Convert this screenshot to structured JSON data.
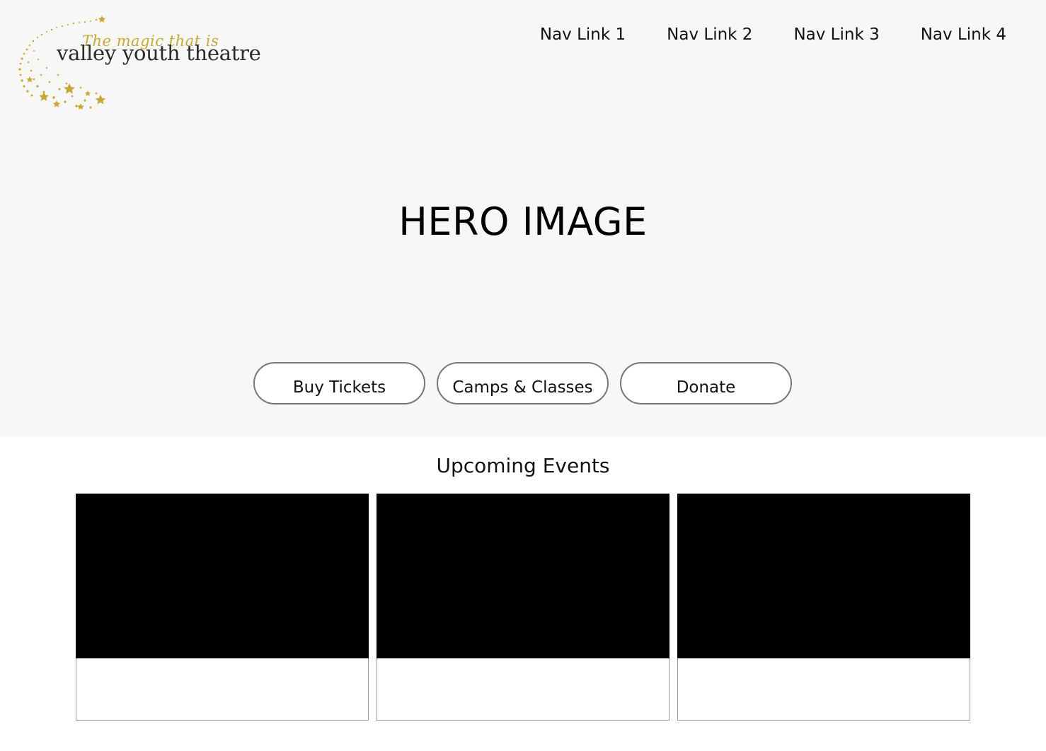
{
  "brand": {
    "tagline": "The magic that is",
    "name": "valley youth theatre",
    "accent_color": "#c6a832",
    "logo_icon": "shooting-stars-icon"
  },
  "nav": {
    "links": [
      "Nav Link 1",
      "Nav Link 2",
      "Nav Link 3",
      "Nav Link 4"
    ]
  },
  "hero": {
    "title": "HERO IMAGE",
    "buttons": [
      "Buy Tickets",
      "Camps & Classes",
      "Donate"
    ]
  },
  "events": {
    "title": "Upcoming Events",
    "cards": [
      {
        "image_color": "#000000"
      },
      {
        "image_color": "#000000"
      },
      {
        "image_color": "#000000"
      }
    ]
  }
}
